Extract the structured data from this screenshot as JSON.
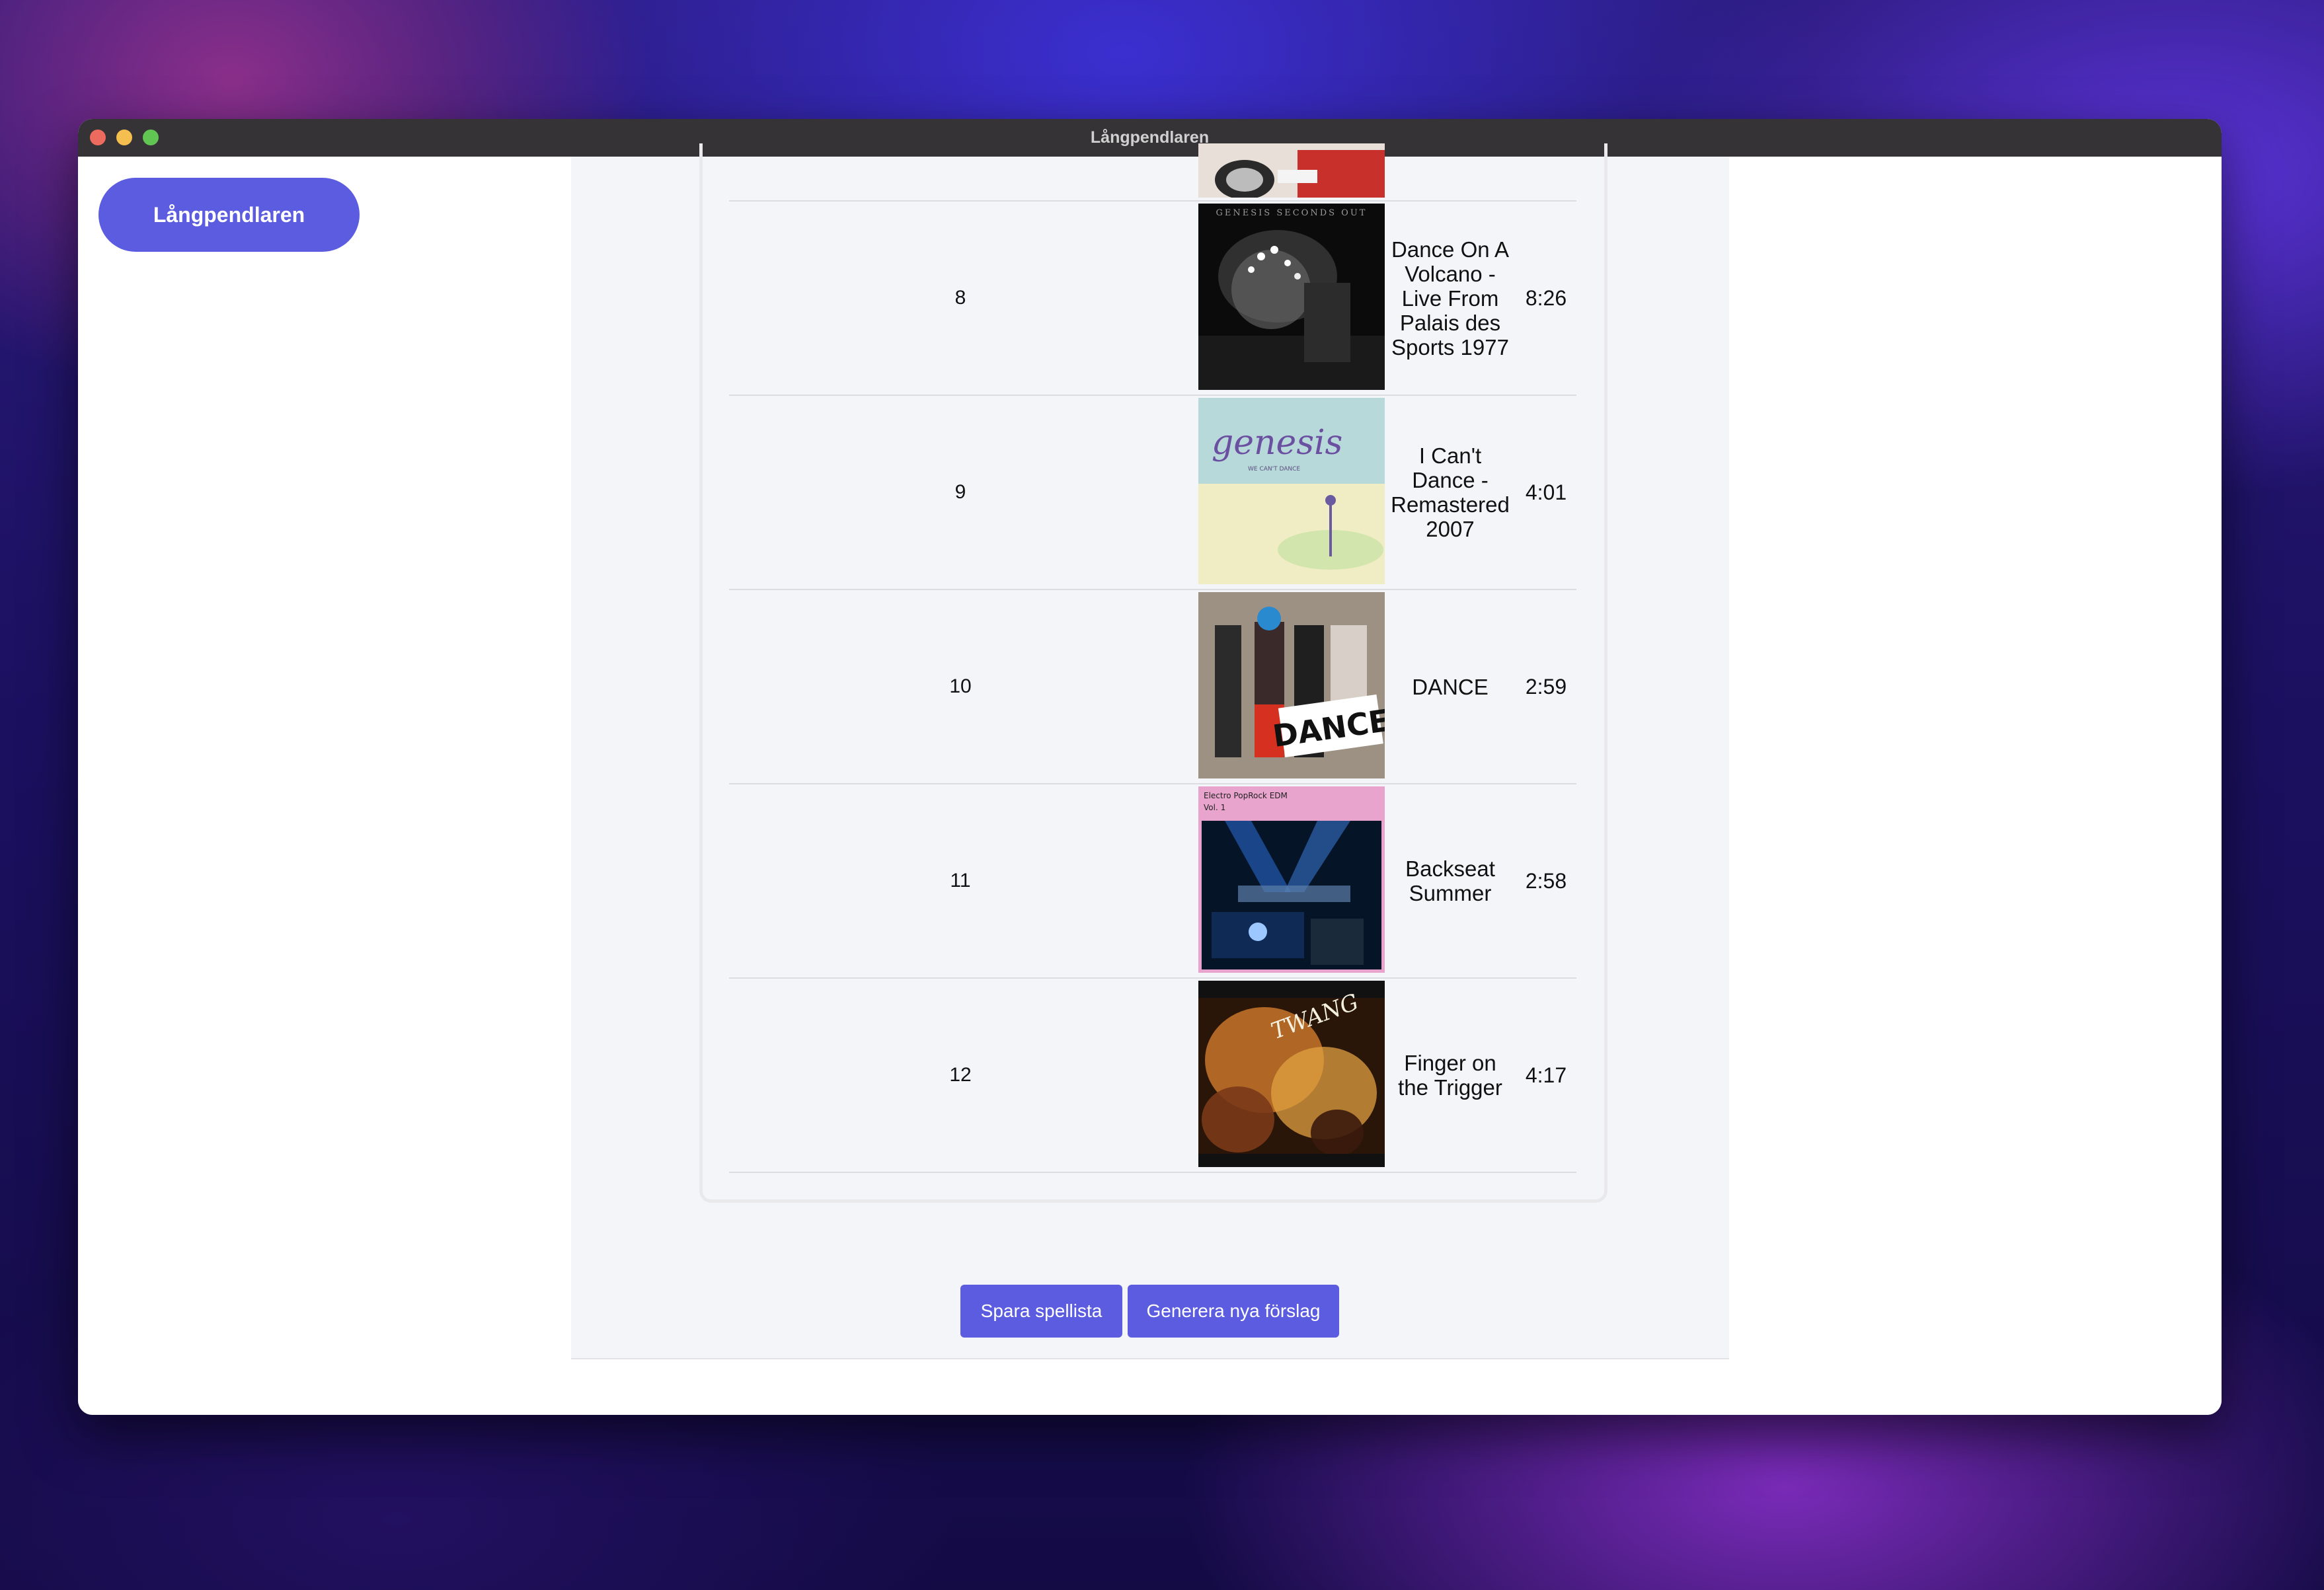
{
  "window": {
    "title": "Långpendlaren"
  },
  "nav": {
    "brand": "Långpendlaren"
  },
  "tracks": [
    {
      "number": "8",
      "title": "Dance On A Volcano - Live From Palais des Sports 1977",
      "duration": "8:26",
      "cover_text": "GENESIS SECONDS OUT"
    },
    {
      "number": "9",
      "title": "I Can't Dance - Remastered 2007",
      "duration": "4:01",
      "cover_text": "genesis",
      "cover_subtext": "WE CAN'T DANCE"
    },
    {
      "number": "10",
      "title": "DANCE",
      "duration": "2:59",
      "cover_text": "DANCE"
    },
    {
      "number": "11",
      "title": "Backseat Summer",
      "duration": "2:58",
      "cover_text": "Electro PopRock EDM",
      "cover_subtext": "Vol. 1"
    },
    {
      "number": "12",
      "title": "Finger on the Trigger",
      "duration": "4:17",
      "cover_text": "TWANG"
    }
  ],
  "actions": {
    "save_label": "Spara spellista",
    "generate_label": "Generera nya förslag"
  },
  "colors": {
    "accent": "#5c5ce0",
    "panel": "#f4f5f9"
  }
}
